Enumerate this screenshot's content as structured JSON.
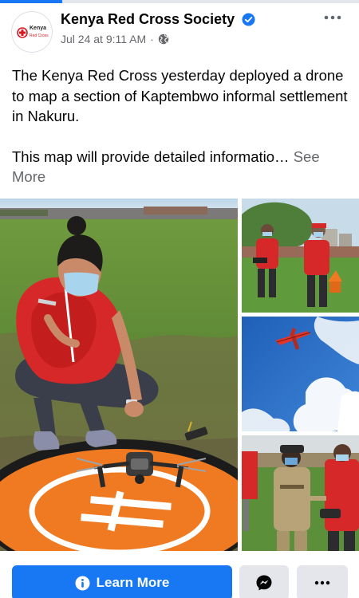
{
  "post": {
    "page_name": "Kenya Red Cross Society",
    "timestamp": "Jul 24 at 9:11 AM",
    "separator": "·",
    "avatar": {
      "line1": "Kenya",
      "line2": "Red Cross"
    },
    "text": {
      "paragraph1": "The Kenya Red Cross yesterday deployed a drone to map a section of Kaptembwo informal settlement in Nakuru.",
      "paragraph2": "This map will provide detailed informatio…",
      "see_more": "See More"
    },
    "icons": {
      "verified": "verified-badge-icon",
      "audience": "globe-icon",
      "more": "more-options-icon"
    }
  },
  "media": {
    "photos": [
      {
        "name": "volunteer-launching-drone-photo"
      },
      {
        "name": "volunteers-with-drone-controller-photo"
      },
      {
        "name": "drone-flying-in-sky-photo"
      },
      {
        "name": "officials-watching-drone-demo-photo"
      }
    ]
  },
  "actions": {
    "learn_more": "Learn More",
    "messenger_icon": "messenger-icon",
    "options_icon": "ellipsis-icon"
  },
  "colors": {
    "brand_blue": "#1877f2",
    "secondary_text": "#65676b",
    "button_gray": "#e4e6eb",
    "red_cross": "#d71920"
  }
}
